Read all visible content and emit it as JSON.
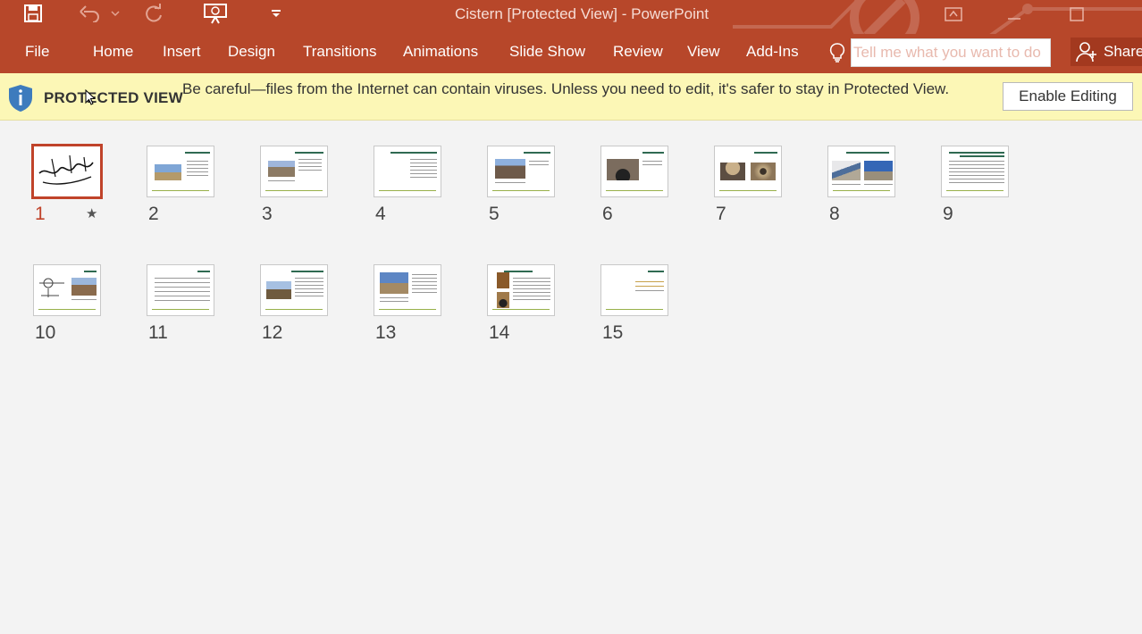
{
  "window": {
    "title": "Cistern [Protected View] - PowerPoint"
  },
  "qat": {
    "icons": [
      "save-icon",
      "undo-icon",
      "redo-icon",
      "present-from-start-icon",
      "customize-qat-icon"
    ]
  },
  "ribbon": {
    "tabs": [
      "File",
      "Home",
      "Insert",
      "Design",
      "Transitions",
      "Animations",
      "Slide Show",
      "Review",
      "View",
      "Add-Ins"
    ],
    "tell_me_placeholder": "Tell me what you want to do",
    "share_label": "Share"
  },
  "protected_view": {
    "title": "PROTECTED VIEW",
    "message": "Be careful—files from the Internet can contain viruses. Unless you need to edit, it's safer to stay in Protected View.",
    "enable_label": "Enable Editing"
  },
  "slides": [
    {
      "number": "1",
      "selected": true,
      "has_animation": true
    },
    {
      "number": "2"
    },
    {
      "number": "3"
    },
    {
      "number": "4"
    },
    {
      "number": "5"
    },
    {
      "number": "6"
    },
    {
      "number": "7"
    },
    {
      "number": "8"
    },
    {
      "number": "9"
    },
    {
      "number": "10"
    },
    {
      "number": "11"
    },
    {
      "number": "12"
    },
    {
      "number": "13"
    },
    {
      "number": "14"
    },
    {
      "number": "15"
    }
  ],
  "colors": {
    "accent": "#b7472a",
    "selection": "#c0432a",
    "protected_bar": "#fcf7b6"
  }
}
